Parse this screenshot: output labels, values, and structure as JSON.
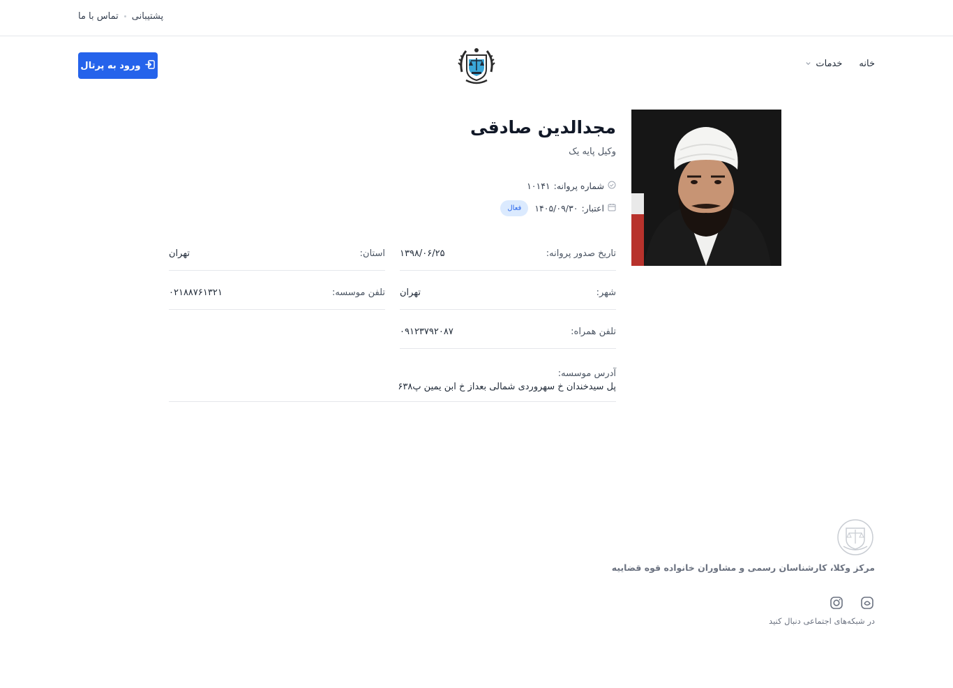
{
  "topbar": {
    "support_label": "پشتیبانی",
    "contact_label": "تماس با ما"
  },
  "header": {
    "portal_label": "ورود به پرتال",
    "nav": {
      "home_label": "خانه",
      "services_label": "خدمات"
    }
  },
  "profile": {
    "name": "مجدالدین صادقی",
    "title": "وکیل پایه یک",
    "license_label": "شماره پروانه:",
    "license_value": "۱۰۱۴۱",
    "validity_label": "اعتبار:",
    "validity_value": "۱۴۰۵/۰۹/۳۰",
    "status": "فعال"
  },
  "details": {
    "issue_date_label": "تاریخ صدور پروانه:",
    "issue_date_value": "۱۳۹۸/۰۶/۲۵",
    "province_label": "استان:",
    "province_value": "تهران",
    "city_label": "شهر:",
    "city_value": "تهران",
    "office_phone_label": "تلفن موسسه:",
    "office_phone_value": "۰۲۱۸۸۷۶۱۳۲۱",
    "mobile_label": "تلفن همراه:",
    "mobile_value": "۰۹۱۲۳۷۹۲۰۸۷",
    "address_label": "آدرس موسسه:",
    "address_value": "پل سیدخندان خ سهروردی شمالی بعداز خ ابن یمین پ۶۳۸"
  },
  "footer": {
    "org_name": "مرکز وکلا، کارشناسان رسمی و مشاوران خانواده قوه قضاییه",
    "social_text": "در شبکه‌های اجتماعی دنبال کنید"
  },
  "colors": {
    "primary": "#2563eb",
    "badge_bg": "#dbeafe",
    "border": "#e5e7eb"
  },
  "icons": [
    "login-icon",
    "emblem-logo",
    "chevron-down-icon",
    "check-circle-icon",
    "calendar-icon",
    "instagram-icon",
    "eitaa-icon"
  ]
}
